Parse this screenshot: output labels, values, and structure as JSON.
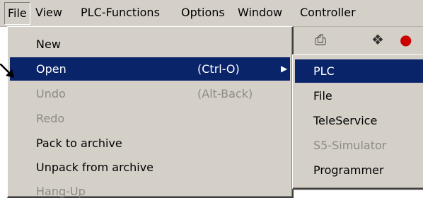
{
  "menubar": {
    "items": [
      {
        "label": "File"
      },
      {
        "label": "View"
      },
      {
        "label": "PLC-Functions"
      },
      {
        "label": "Options"
      },
      {
        "label": "Window"
      },
      {
        "label": "Controller"
      }
    ]
  },
  "file_menu": {
    "items": [
      {
        "label": "New",
        "shortcut": ""
      },
      {
        "label": "Open",
        "shortcut": "(Ctrl-O)"
      },
      {
        "label": "Undo",
        "shortcut": "(Alt-Back)"
      },
      {
        "label": "Redo",
        "shortcut": ""
      },
      {
        "label": "Pack to archive",
        "shortcut": ""
      },
      {
        "label": "Unpack from archive",
        "shortcut": ""
      },
      {
        "label": "Hang-Up",
        "shortcut": ""
      }
    ]
  },
  "open_submenu": {
    "items": [
      {
        "label": "PLC"
      },
      {
        "label": "File"
      },
      {
        "label": "TeleService"
      },
      {
        "label": "S5-Simulator"
      },
      {
        "label": "Programmer"
      }
    ]
  },
  "colors": {
    "menu_bg": "#d4d0c8",
    "highlight": "#0a246a",
    "disabled_text": "#8c8a84"
  }
}
